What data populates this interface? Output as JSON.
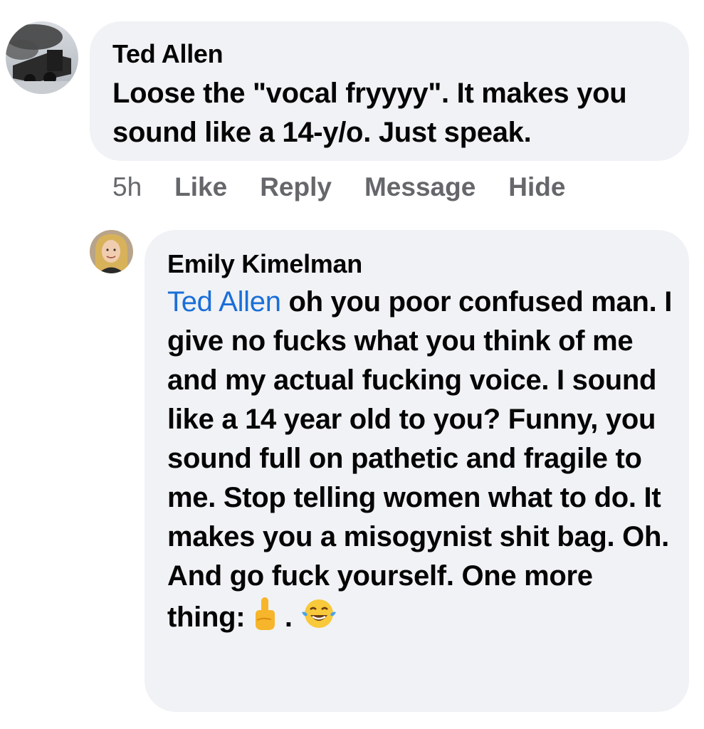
{
  "comments": [
    {
      "author": "Ted Allen",
      "text": "Loose the \"vocal fryyyy\". It makes you sound like a 14-y/o. Just speak.",
      "avatar": "train-photo-icon",
      "actions": {
        "time": "5h",
        "like": "Like",
        "reply": "Reply",
        "message": "Message",
        "hide": "Hide"
      }
    },
    {
      "author": "Emily Kimelman",
      "mention": "Ted Allen",
      "text": " oh you poor confused man. I give no fucks what you think of me and my actual fucking voice. I sound like a 14 year old to you? Funny, you sound full on pathetic and fragile to me. Stop telling women what to do. It makes you a misogynist shit bag. Oh. And go fuck yourself. One more thing: ",
      "emojis": [
        "middle-finger-emoji",
        "laughing-tears-emoji"
      ],
      "separator": ".",
      "avatar": "profile-photo-icon"
    }
  ],
  "colors": {
    "bubble": "#f0f2f5",
    "mention": "#1a6ed8",
    "meta": "#65676b",
    "text": "#050505"
  }
}
